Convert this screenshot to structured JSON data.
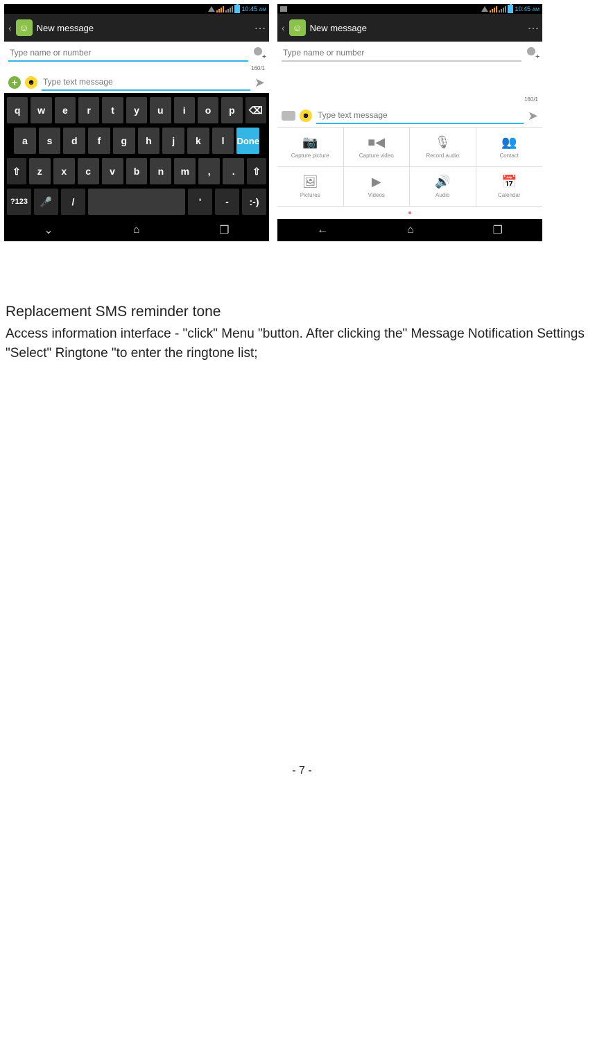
{
  "status": {
    "time": "10:45",
    "am": "AM"
  },
  "header": {
    "title": "New message"
  },
  "recipient": {
    "placeholder": "Type name or number"
  },
  "compose": {
    "placeholder": "Type text message",
    "counter": "160/1"
  },
  "keyboard": {
    "row1": [
      "q",
      "w",
      "e",
      "r",
      "t",
      "y",
      "u",
      "i",
      "o",
      "p"
    ],
    "row2": [
      "a",
      "s",
      "d",
      "f",
      "g",
      "h",
      "j",
      "k",
      "l"
    ],
    "done": "Done",
    "row3": [
      "z",
      "x",
      "c",
      "v",
      "b",
      "n",
      "m",
      ",",
      "."
    ],
    "row4": {
      "num": "?123",
      "slash": "/",
      "apos": "'",
      "dash": "-",
      "smile": ":-)"
    }
  },
  "attachments": [
    {
      "label": "Capture picture",
      "icon": "camera"
    },
    {
      "label": "Capture video",
      "icon": "video"
    },
    {
      "label": "Record audio",
      "icon": "mic"
    },
    {
      "label": "Contact",
      "icon": "contact"
    },
    {
      "label": "Pictures",
      "icon": "image"
    },
    {
      "label": "Videos",
      "icon": "play"
    },
    {
      "label": "Audio",
      "icon": "speaker"
    },
    {
      "label": "Calendar",
      "icon": "calendar"
    }
  ],
  "doc": {
    "heading": "Replacement SMS reminder tone",
    "paragraph": "Access information interface - \"click\" Menu \"button. After clicking the\" Message Notification Settings \"Select\" Ringtone \"to enter the ringtone list;"
  },
  "page_number": "- 7 -"
}
